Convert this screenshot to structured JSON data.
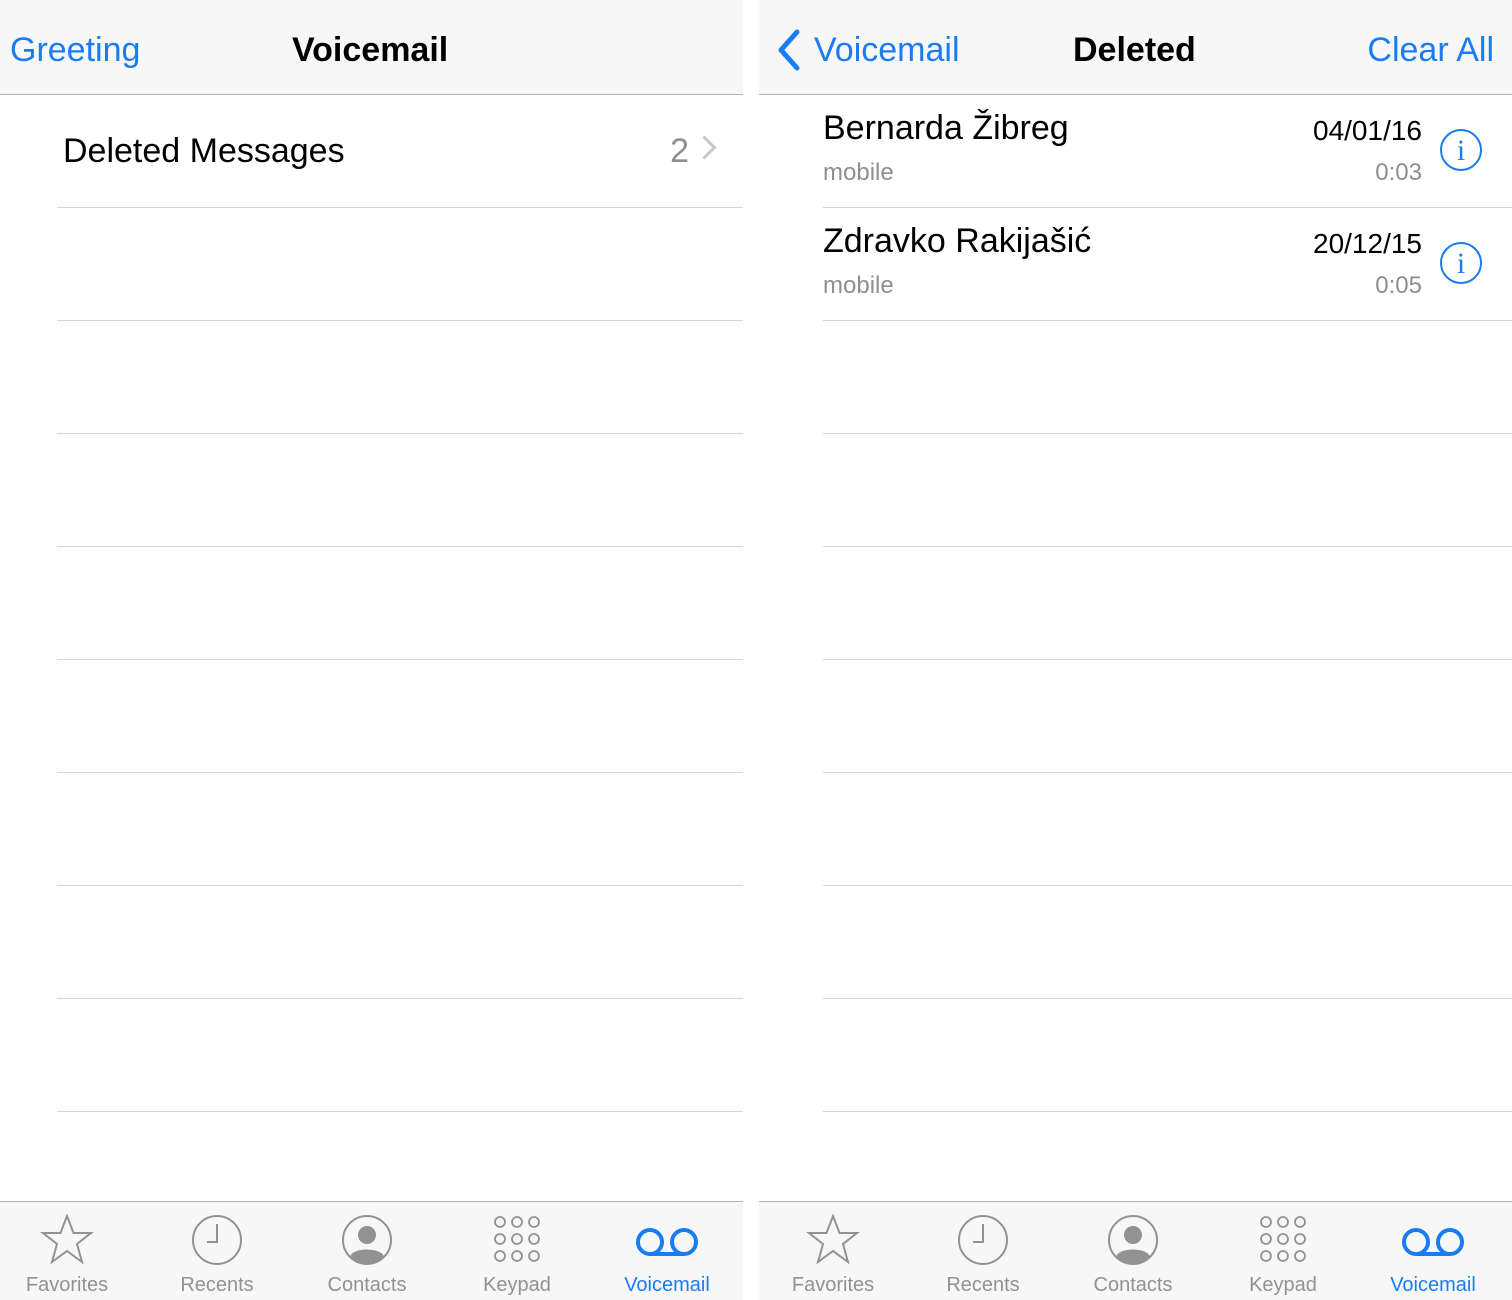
{
  "left": {
    "navbar": {
      "left_button": "Greeting",
      "title": "Voicemail"
    },
    "deleted_row": {
      "label": "Deleted Messages",
      "count": "2"
    }
  },
  "right": {
    "navbar": {
      "back_button": "Voicemail",
      "title": "Deleted",
      "right_button": "Clear All"
    },
    "messages": [
      {
        "name": "Bernarda Žibreg",
        "type": "mobile",
        "date": "04/01/16",
        "duration": "0:03"
      },
      {
        "name": "Zdravko Rakijašić",
        "type": "mobile",
        "date": "20/12/15",
        "duration": "0:05"
      }
    ]
  },
  "tabbar": {
    "tabs": [
      {
        "label": "Favorites",
        "icon": "star-icon"
      },
      {
        "label": "Recents",
        "icon": "clock-icon"
      },
      {
        "label": "Contacts",
        "icon": "person-icon"
      },
      {
        "label": "Keypad",
        "icon": "keypad-icon"
      },
      {
        "label": "Voicemail",
        "icon": "voicemail-icon"
      }
    ],
    "active": "Voicemail"
  },
  "colors": {
    "accent": "#1a7cf2",
    "inactive": "#929292",
    "bar_bg": "#f7f7f7",
    "separator": "#d6d6da"
  }
}
